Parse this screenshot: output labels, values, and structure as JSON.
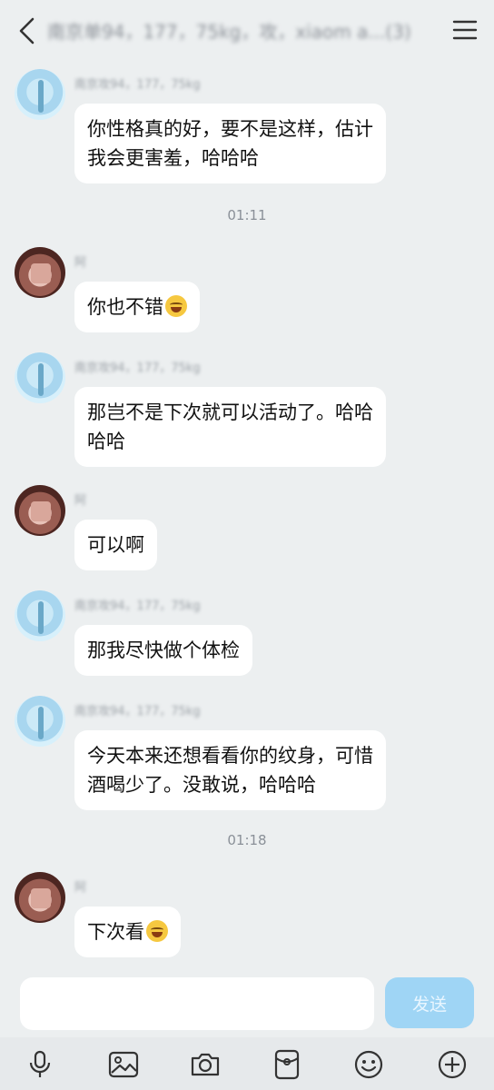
{
  "header": {
    "title": "南京单94，177，75kg，攻，xiaom a...(3)",
    "back_icon": "chevron-left-icon",
    "menu_icon": "hamburger-menu-icon"
  },
  "messages": [
    {
      "sender": "南京攻94，177，75kg",
      "avatar": "avatar-a",
      "lines": [
        "你性格真的好，要不是这样，估计",
        "我会更害羞，哈哈哈"
      ]
    },
    {
      "sender": "阿",
      "avatar": "avatar-b",
      "lines": [
        "你也不错"
      ],
      "emoji": "laughing-tears-emoji"
    },
    {
      "sender": "南京攻94，177，75kg",
      "avatar": "avatar-a",
      "lines": [
        "那岂不是下次就可以活动了。哈哈",
        "哈哈"
      ]
    },
    {
      "sender": "阿",
      "avatar": "avatar-b",
      "lines": [
        "可以啊"
      ]
    },
    {
      "sender": "南京攻94，177，75kg",
      "avatar": "avatar-a",
      "lines": [
        "那我尽快做个体检"
      ]
    },
    {
      "sender": "南京攻94，177，75kg",
      "avatar": "avatar-a",
      "lines": [
        "今天本来还想看看你的纹身，可惜",
        "酒喝少了。没敢说，哈哈哈"
      ]
    },
    {
      "sender": "阿",
      "avatar": "avatar-b",
      "lines": [
        "下次看"
      ],
      "emoji": "laughing-tears-emoji"
    }
  ],
  "timestamps": [
    "01:11",
    "01:18"
  ],
  "composer": {
    "placeholder": "",
    "send_label": "发送",
    "accent": "#9fd5f5"
  },
  "toolbar": {
    "icons": [
      "microphone-icon",
      "image-icon",
      "camera-icon",
      "red-packet-icon",
      "emoji-icon",
      "plus-icon"
    ]
  }
}
